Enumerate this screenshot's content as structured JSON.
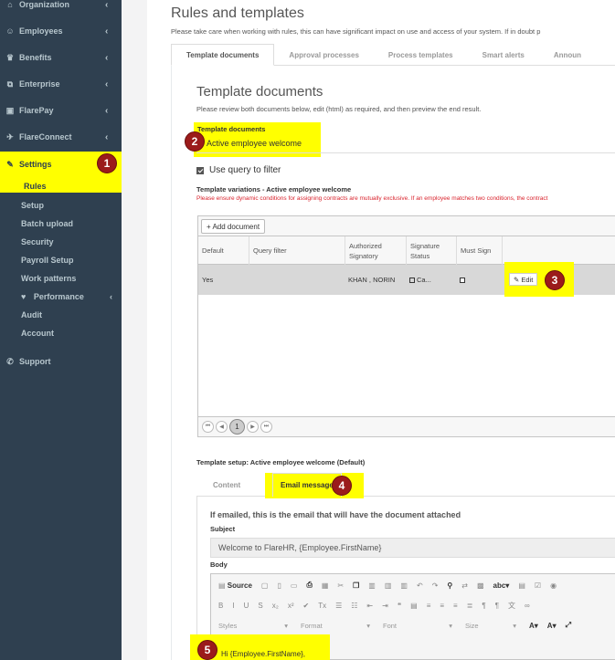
{
  "sidebar": {
    "items": [
      {
        "icon": "bank-icon",
        "glyph": "⌂",
        "label": "Organization"
      },
      {
        "icon": "users-icon",
        "glyph": "👥",
        "label": "Employees"
      },
      {
        "icon": "trophy-icon",
        "glyph": "🏆",
        "label": "Benefits"
      },
      {
        "icon": "sitemap-icon",
        "glyph": "⧉",
        "label": "Enterprise"
      },
      {
        "icon": "money-icon",
        "glyph": "▣",
        "label": "FlarePay"
      },
      {
        "icon": "rocket-icon",
        "glyph": "✈",
        "label": "FlareConnect"
      }
    ],
    "settings": {
      "icon": "edit-icon",
      "glyph": "✎",
      "label": "Settings"
    },
    "settings_sub": [
      {
        "label": "Rules"
      },
      {
        "label": "Setup"
      },
      {
        "label": "Batch upload"
      },
      {
        "label": "Security"
      },
      {
        "label": "Payroll Setup"
      },
      {
        "label": "Work patterns"
      }
    ],
    "performance": {
      "glyph": "♥",
      "label": "Performance"
    },
    "settings_sub2": [
      {
        "label": "Audit"
      },
      {
        "label": "Account"
      }
    ],
    "support": {
      "glyph": "✆",
      "label": "Support"
    },
    "chevron": "‹"
  },
  "badges": {
    "b1": "1",
    "b2": "2",
    "b3": "3",
    "b4": "4",
    "b5": "5"
  },
  "page": {
    "title": "Rules and templates",
    "warning": "Please take care when working with rules, this can have significant impact on use and access of your system. If in doubt p",
    "tabs": [
      "Template documents",
      "Approval processes",
      "Process templates",
      "Smart alerts",
      "Announ"
    ]
  },
  "template": {
    "heading": "Template documents",
    "instructions": "Please review both documents below, edit (html) as required, and then preview the end result.",
    "select_label": "Template documents",
    "select_value": "Active employee welcome",
    "use_query_label": "Use query to filter"
  },
  "variations": {
    "title": "Template variations - Active employee welcome",
    "warning": "Please ensure dynamic conditions for assigning contracts are mutually exclusive. If an employee matches two conditions, the contract",
    "add_button": "+ Add document",
    "headers": [
      "Default",
      "Query filter",
      "Authorized Signatory",
      "Signature Status",
      "Must Sign"
    ],
    "row": {
      "default": "Yes",
      "query": "",
      "signatory": "KHAN , NORIN",
      "status": "Ca...",
      "edit": "✎ Edit"
    },
    "pager": {
      "first": "⏮",
      "prev": "◀",
      "current": "1",
      "next": "▶",
      "last": "⏭"
    }
  },
  "setup": {
    "title": "Template setup: Active employee welcome (Default)",
    "tabs": [
      "Content",
      "Email message"
    ],
    "email_heading": "If emailed, this is the email that will have the document attached",
    "subject_label": "Subject",
    "subject_value": "Welcome to FlareHR, {Employee.FirstName}",
    "body_label": "Body",
    "source_label": "Source",
    "styles_label": "Styles",
    "format_label": "Format",
    "font_label": "Font",
    "size_label": "Size",
    "body_greeting": "Hi {Employee.FirstName},"
  }
}
